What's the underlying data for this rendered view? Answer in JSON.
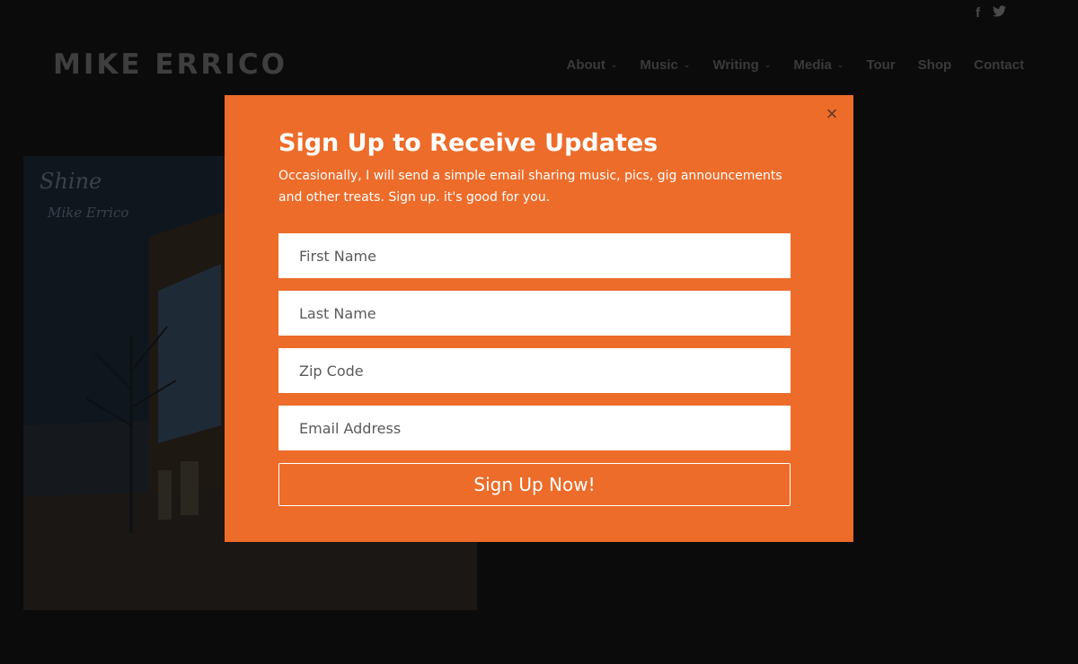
{
  "social": {
    "facebook_icon": "f",
    "twitter_icon": "🐦"
  },
  "header": {
    "logo": "MIKE ERRICO",
    "nav": [
      {
        "label": "About",
        "has_dropdown": true
      },
      {
        "label": "Music",
        "has_dropdown": true
      },
      {
        "label": "Writing",
        "has_dropdown": true
      },
      {
        "label": "Media",
        "has_dropdown": true
      },
      {
        "label": "Tour",
        "has_dropdown": false
      },
      {
        "label": "Shop",
        "has_dropdown": false
      },
      {
        "label": "Contact",
        "has_dropdown": false
      }
    ]
  },
  "album": {
    "title": "Shine",
    "artist": "Mike Errico"
  },
  "popup": {
    "close": "×",
    "title": "Sign Up to Receive Updates",
    "description": "Occasionally, I will send a simple email sharing music, pics, gig announcements and other treats. Sign up. it's good for you.",
    "fields": {
      "first_name": "First Name",
      "last_name": "Last Name",
      "zip": "Zip Code",
      "email": "Email Address"
    },
    "submit": "Sign Up Now!"
  },
  "colors": {
    "accent": "#ed6c2a",
    "background": "#0b0b0b"
  }
}
